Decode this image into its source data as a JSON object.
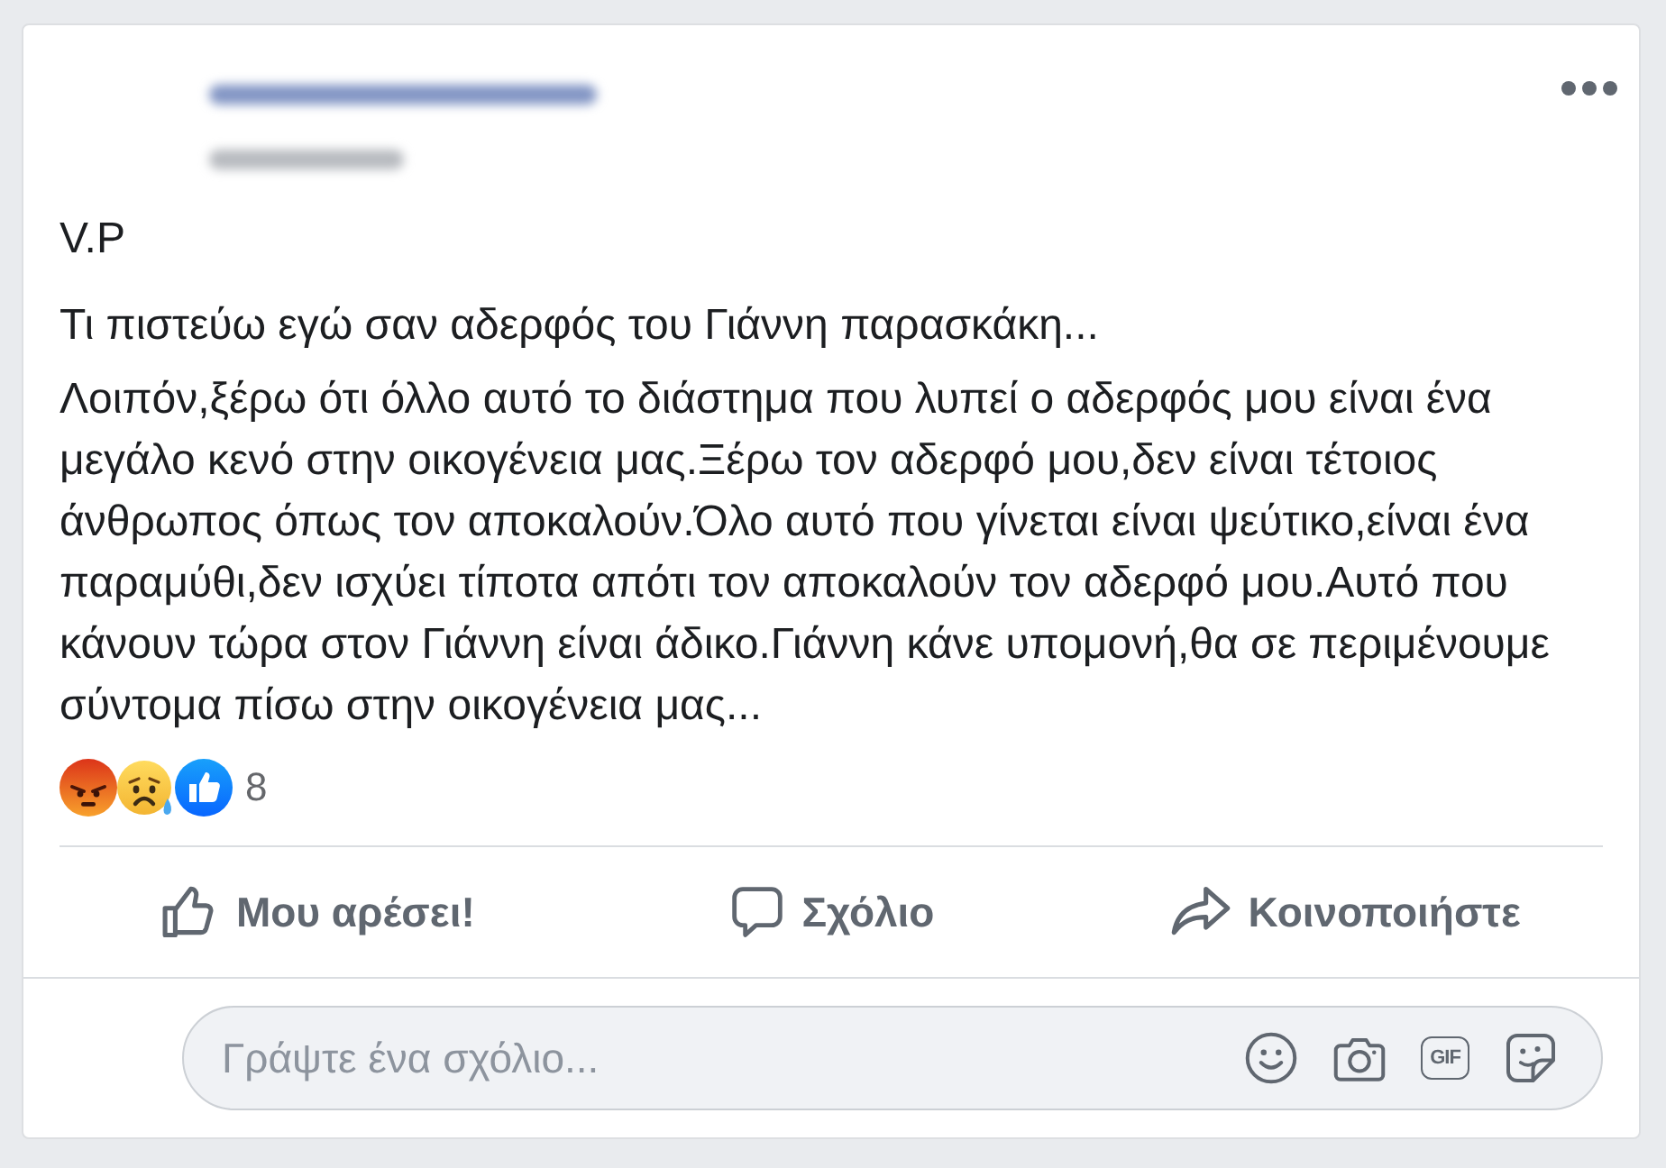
{
  "post": {
    "title": "V.P",
    "subtitle": "Τι πιστεύω εγώ σαν αδερφός του Γιάννη παρασκάκη...",
    "body": "Λοιπόν,ξέρω ότι όλλο αυτό το διάστημα που λυπεί ο αδερφός μου είναι ένα μεγάλο κενό στην οικογένεια μας.Ξέρω τον αδερφό μου,δεν είναι τέτοιος άνθρωπος όπως τον αποκαλούν.Όλο αυτό που γίνεται είναι ψεύτικο,είναι ένα παραμύθι,δεν ισχύει τίποτα απότι τον αποκαλούν τον αδερφό μου.Αυτό που κάνουν τώρα στον Γιάννη είναι άδικο.Γιάννη κάνε υπομονή,θα σε περιμένουμε σύντομα πίσω στην οικογένεια μας...",
    "reactions": {
      "icons": [
        {
          "kind": "angry"
        },
        {
          "kind": "sad"
        },
        {
          "kind": "like"
        }
      ],
      "count": "8"
    },
    "actions": [
      {
        "kind": "like",
        "label": "Μου αρέσει!"
      },
      {
        "kind": "comment",
        "label": "Σχόλιο"
      },
      {
        "kind": "share",
        "label": "Κοινοποιήστε"
      }
    ],
    "comment_box": {
      "placeholder": "Γράψτε ένα σχόλιο...",
      "tools": [
        {
          "kind": "emoji"
        },
        {
          "kind": "camera"
        },
        {
          "kind": "gif",
          "label": "GIF"
        },
        {
          "kind": "sticker"
        }
      ]
    }
  }
}
